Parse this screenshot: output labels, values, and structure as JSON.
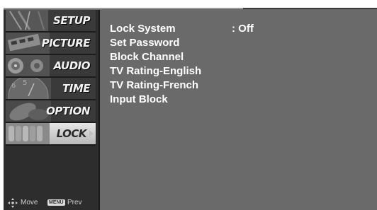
{
  "sidebar": {
    "items": [
      {
        "label": "SETUP"
      },
      {
        "label": "PICTURE"
      },
      {
        "label": "AUDIO"
      },
      {
        "label": "TIME"
      },
      {
        "label": "OPTION"
      },
      {
        "label": "LOCK",
        "active": true
      }
    ]
  },
  "footer": {
    "move_label": "Move",
    "menu_key": "MENU",
    "prev_label": "Prev"
  },
  "main": {
    "options": [
      {
        "label": "Lock System",
        "value": ": Off"
      },
      {
        "label": "Set Password"
      },
      {
        "label": "Block Channel"
      },
      {
        "label": "TV Rating-English"
      },
      {
        "label": "TV Rating-French"
      },
      {
        "label": "Input Block"
      }
    ]
  },
  "colors": {
    "background": "#6a6a6a",
    "sidebar": "#2d2d2d",
    "text": "#ffffff",
    "active_item": "#d0d0d0"
  }
}
